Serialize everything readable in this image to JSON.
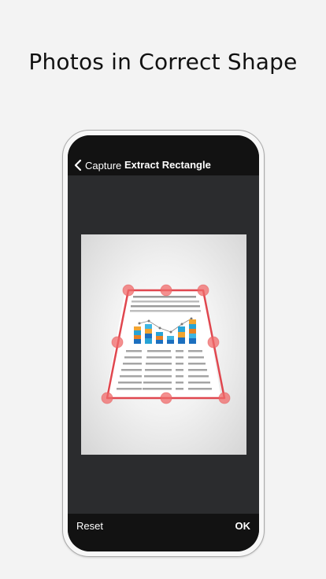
{
  "headline": "Photos in Correct Shape",
  "navbar": {
    "back_label": "Capture",
    "title": "Extract Rectangle"
  },
  "toolbar": {
    "reset_label": "Reset",
    "ok_label": "OK"
  },
  "colors": {
    "crop_outline": "#e0474f",
    "handle_fill": "#f06a6a"
  }
}
